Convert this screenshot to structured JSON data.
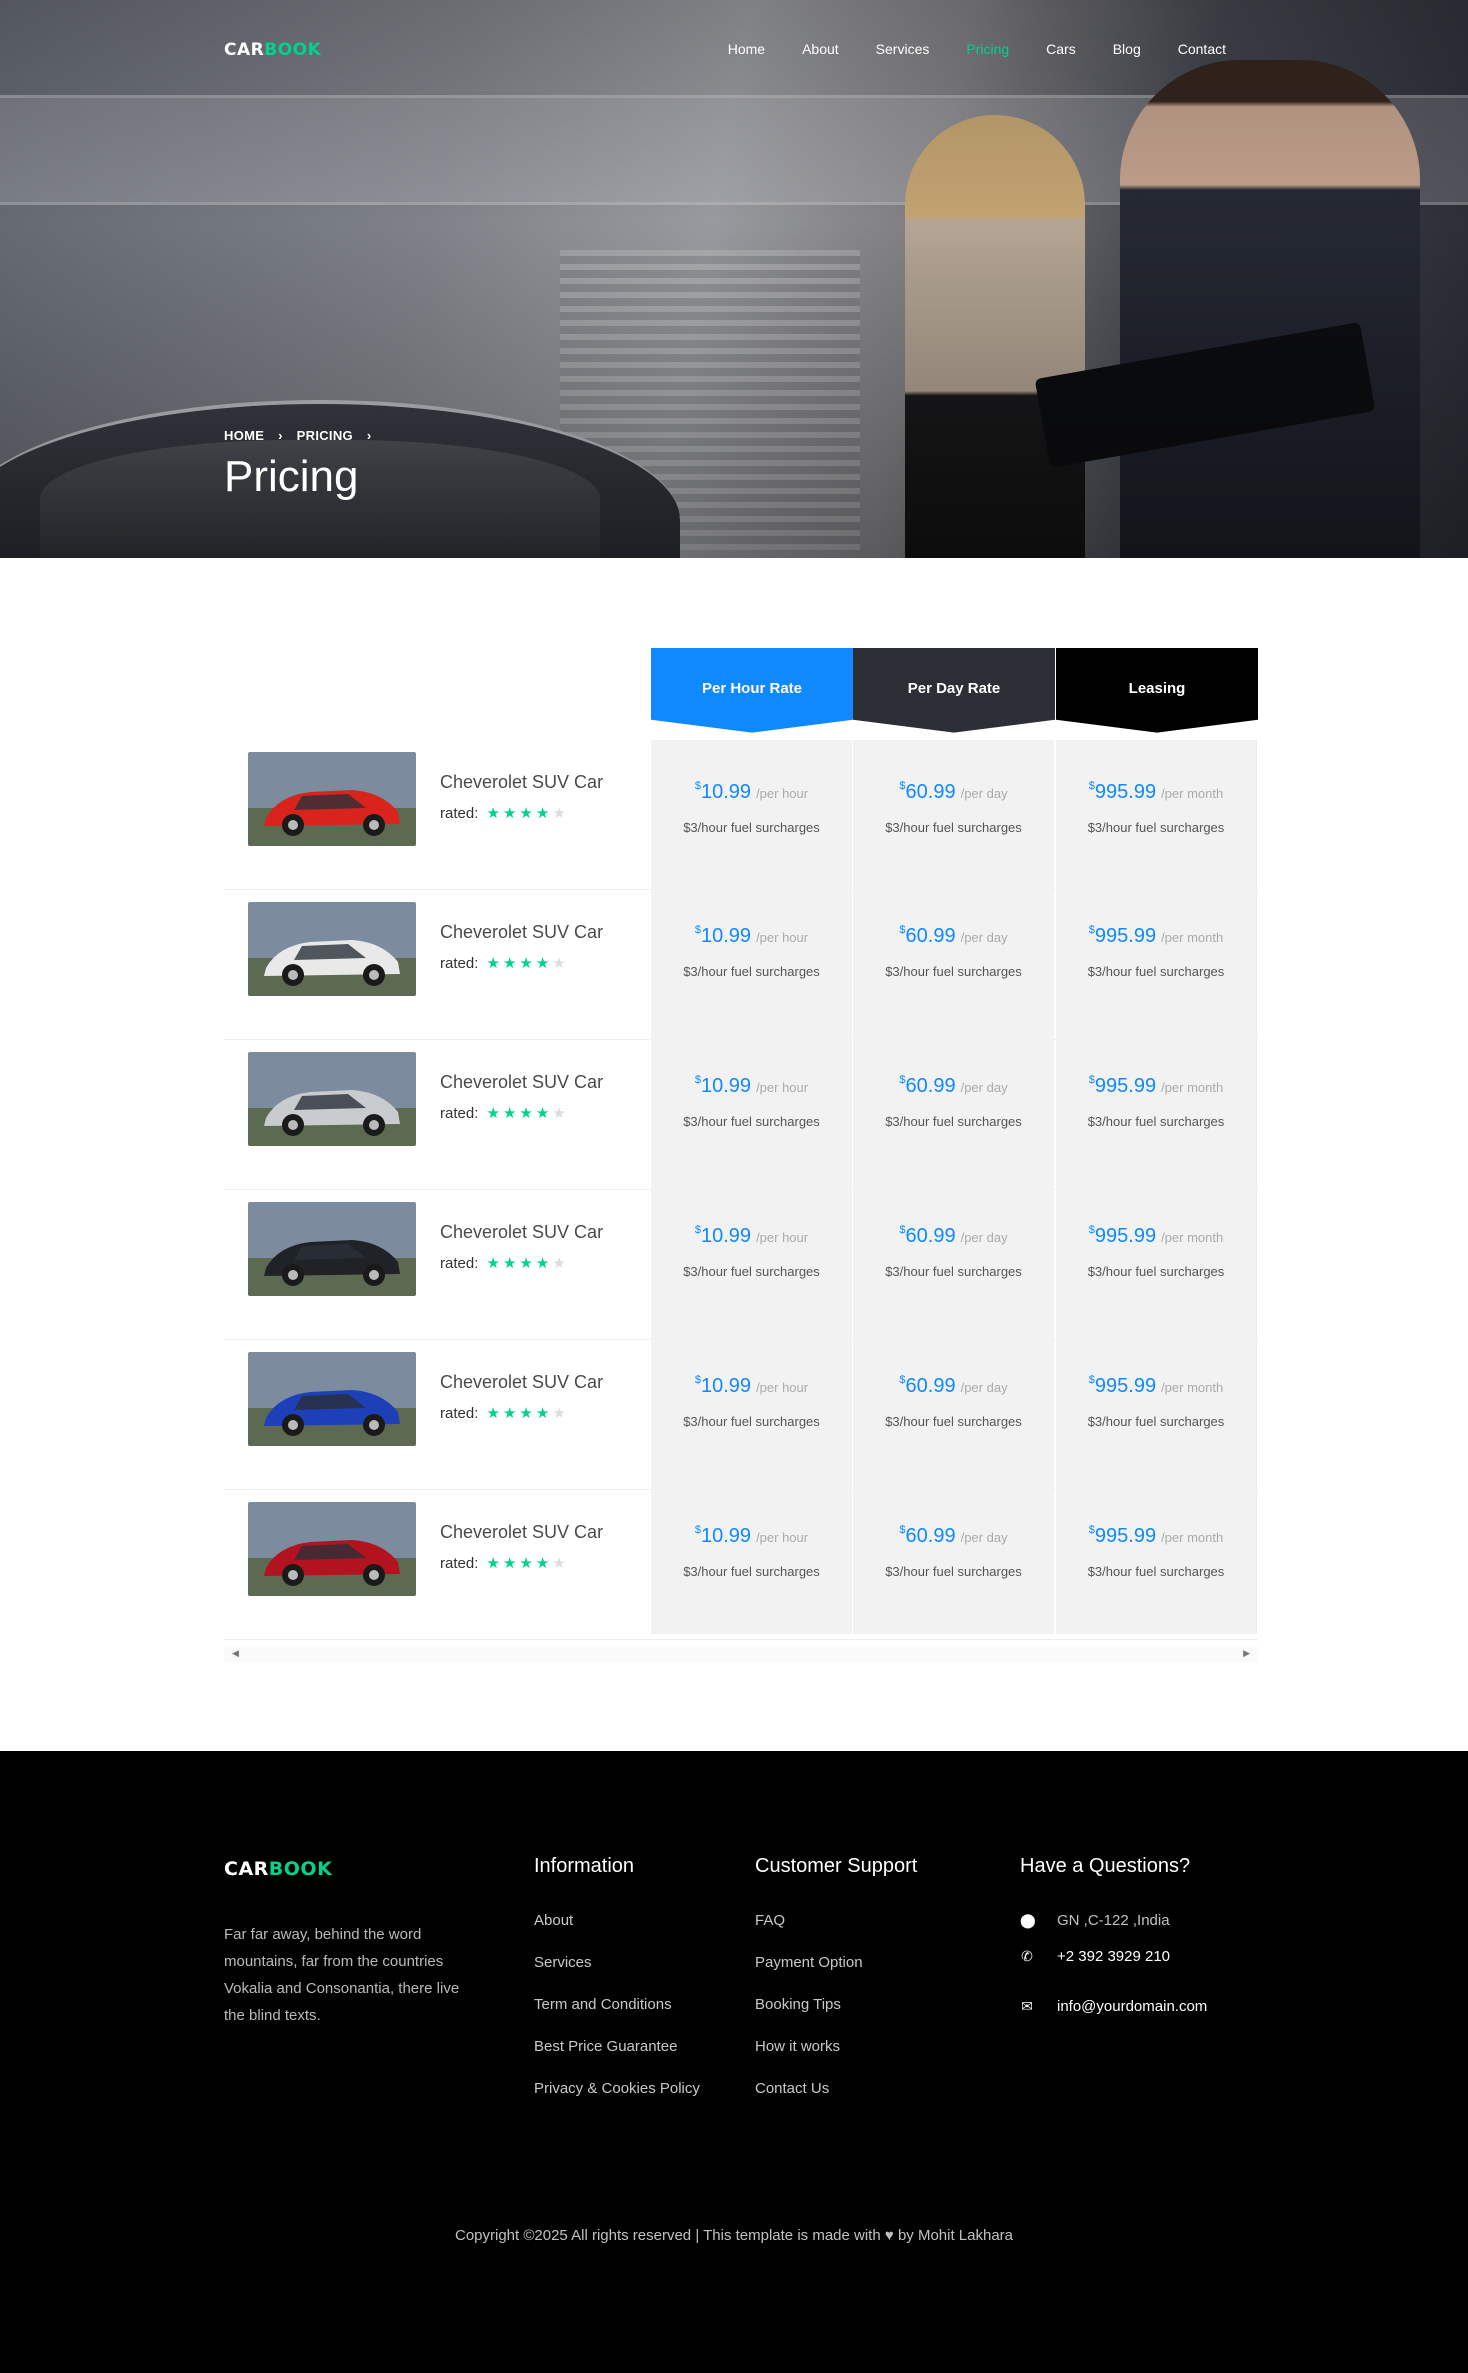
{
  "brand": {
    "part1": "CAR",
    "part2": "BOOK"
  },
  "nav": {
    "items": [
      "Home",
      "About",
      "Services",
      "Pricing",
      "Cars",
      "Blog",
      "Contact"
    ],
    "active": "Pricing"
  },
  "hero": {
    "breadcrumb": [
      "HOME",
      "PRICING"
    ],
    "title": "Pricing"
  },
  "pricing": {
    "headers": [
      "Per Hour Rate",
      "Per Day Rate",
      "Leasing"
    ],
    "rows": [
      {
        "car": "Cheverolet SUV Car",
        "rated_label": "rated:",
        "stars": 4,
        "hour": "10.99",
        "day": "60.99",
        "month": "995.99"
      },
      {
        "car": "Cheverolet SUV Car",
        "rated_label": "rated:",
        "stars": 4,
        "hour": "10.99",
        "day": "60.99",
        "month": "995.99"
      },
      {
        "car": "Cheverolet SUV Car",
        "rated_label": "rated:",
        "stars": 4,
        "hour": "10.99",
        "day": "60.99",
        "month": "995.99"
      },
      {
        "car": "Cheverolet SUV Car",
        "rated_label": "rated:",
        "stars": 4,
        "hour": "10.99",
        "day": "60.99",
        "month": "995.99"
      },
      {
        "car": "Cheverolet SUV Car",
        "rated_label": "rated:",
        "stars": 4,
        "hour": "10.99",
        "day": "60.99",
        "month": "995.99"
      },
      {
        "car": "Cheverolet SUV Car",
        "rated_label": "rated:",
        "stars": 4,
        "hour": "10.99",
        "day": "60.99",
        "month": "995.99"
      }
    ],
    "currency": "$",
    "per_hour": "/per hour",
    "per_day": "/per day",
    "per_month": "/per month",
    "fuel": "$3/hour fuel surcharges",
    "car_colors": [
      "#d9241e",
      "#e9e9ea",
      "#c9cccf",
      "#1f2226",
      "#1d3fb8",
      "#b3121f"
    ]
  },
  "footer": {
    "about_text": "Far far away, behind the word mountains, far from the countries Vokalia and Consonantia, there live the blind texts.",
    "information": {
      "title": "Information",
      "links": [
        "About",
        "Services",
        "Term and Conditions",
        "Best Price Guarantee",
        "Privacy & Cookies Policy"
      ]
    },
    "support": {
      "title": "Customer Support",
      "links": [
        "FAQ",
        "Payment Option",
        "Booking Tips",
        "How it works",
        "Contact Us"
      ]
    },
    "questions": {
      "title": "Have a Questions?",
      "address": "GN ,C-122 ,India",
      "phone": "+2 392 3929 210",
      "email": "info@yourdomain.com"
    },
    "copyright_pre": "Copyright ©2025 All rights reserved | This template is made with",
    "copyright_post": "by Mohit Lakhara"
  },
  "accent_colors": {
    "green": "#01d28e",
    "blue": "#1089ff",
    "dark": "#2d2f37"
  }
}
